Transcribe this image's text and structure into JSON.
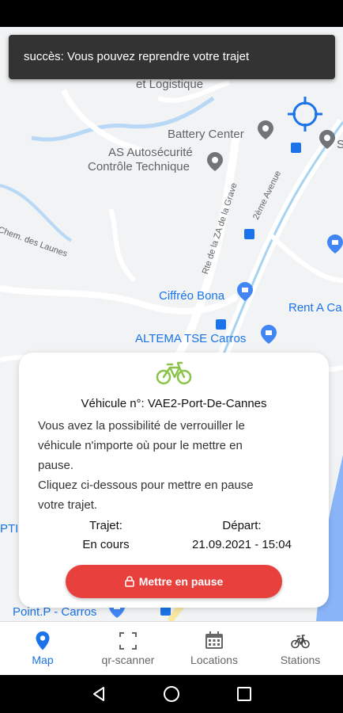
{
  "toast": {
    "message": "succès: Vous pouvez reprendre votre trajet"
  },
  "map": {
    "labels": {
      "logistique": "et Logistique",
      "battery": "Battery Center",
      "as_line1": "AS Autosécurité",
      "as_line2": "Contrôle Technique",
      "chem": "Chem. des Launes",
      "rte": "Rte de la ZA de la Grave",
      "avenue": "2ème Avenue",
      "ciffreo": "Ciffréo Bona",
      "rent": "Rent A Ca",
      "altema": "ALTEMA TSE Carros",
      "ptic": "PTIC",
      "pointp": "Point.P - Carros",
      "s_edge": "S"
    }
  },
  "card": {
    "vehicle_label": "Véhicule n°: VAE2-Port-De-Cannes",
    "info_line1": "Vous avez la possibilité de verrouiller le",
    "info_line2": "véhicule n'importe où pour le mettre en",
    "info_line3": "pause.",
    "info_line4": "Cliquez ci-dessous pour mettre en pause",
    "info_line5": "votre trajet.",
    "trajet_label": "Trajet:",
    "trajet_value": "En cours",
    "depart_label": "Départ:",
    "depart_value": "21.09.2021 - 15:04",
    "pause_button": "Mettre en pause",
    "accent_color": "#e8413d",
    "bike_color": "#8bc34a"
  },
  "nav": {
    "items": [
      {
        "label": "Map",
        "icon": "map-pin-icon",
        "active": true
      },
      {
        "label": "qr-scanner",
        "icon": "scan-frame-icon",
        "active": false
      },
      {
        "label": "Locations",
        "icon": "calendar-icon",
        "active": false
      },
      {
        "label": "Stations",
        "icon": "bicycle-icon",
        "active": false
      }
    ],
    "active_color": "#1a73e8"
  },
  "system_nav": {
    "back": "back-triangle-icon",
    "home": "home-circle-icon",
    "recents": "recents-square-icon"
  }
}
